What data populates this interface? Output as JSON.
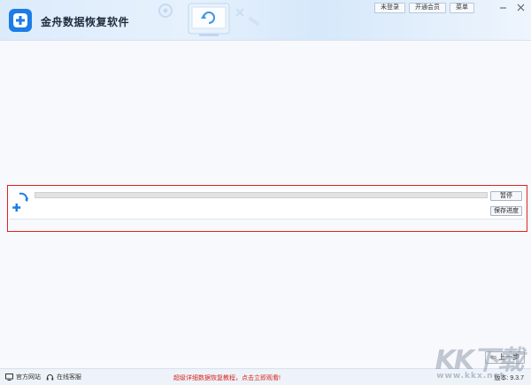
{
  "app": {
    "title": "金舟数据恢复软件"
  },
  "header": {
    "buttons": [
      "未登录",
      "开通会员",
      "菜单"
    ]
  },
  "progress": {
    "value": 0,
    "pause_label": "暂停",
    "save_label": "保存进度"
  },
  "nav": {
    "prev_label": "上一步"
  },
  "footer": {
    "official_site": "官方网站",
    "online_service": "在线客服",
    "promo": "超级详细数据恢复教程，点击立即观看!",
    "version": "版本: 9.3.7"
  },
  "watermark": {
    "text": "KK下载",
    "url": "www.kkx.net"
  },
  "colors": {
    "accent": "#1c7de6",
    "highlight_border": "#e0241f",
    "promo": "#d8261d"
  }
}
